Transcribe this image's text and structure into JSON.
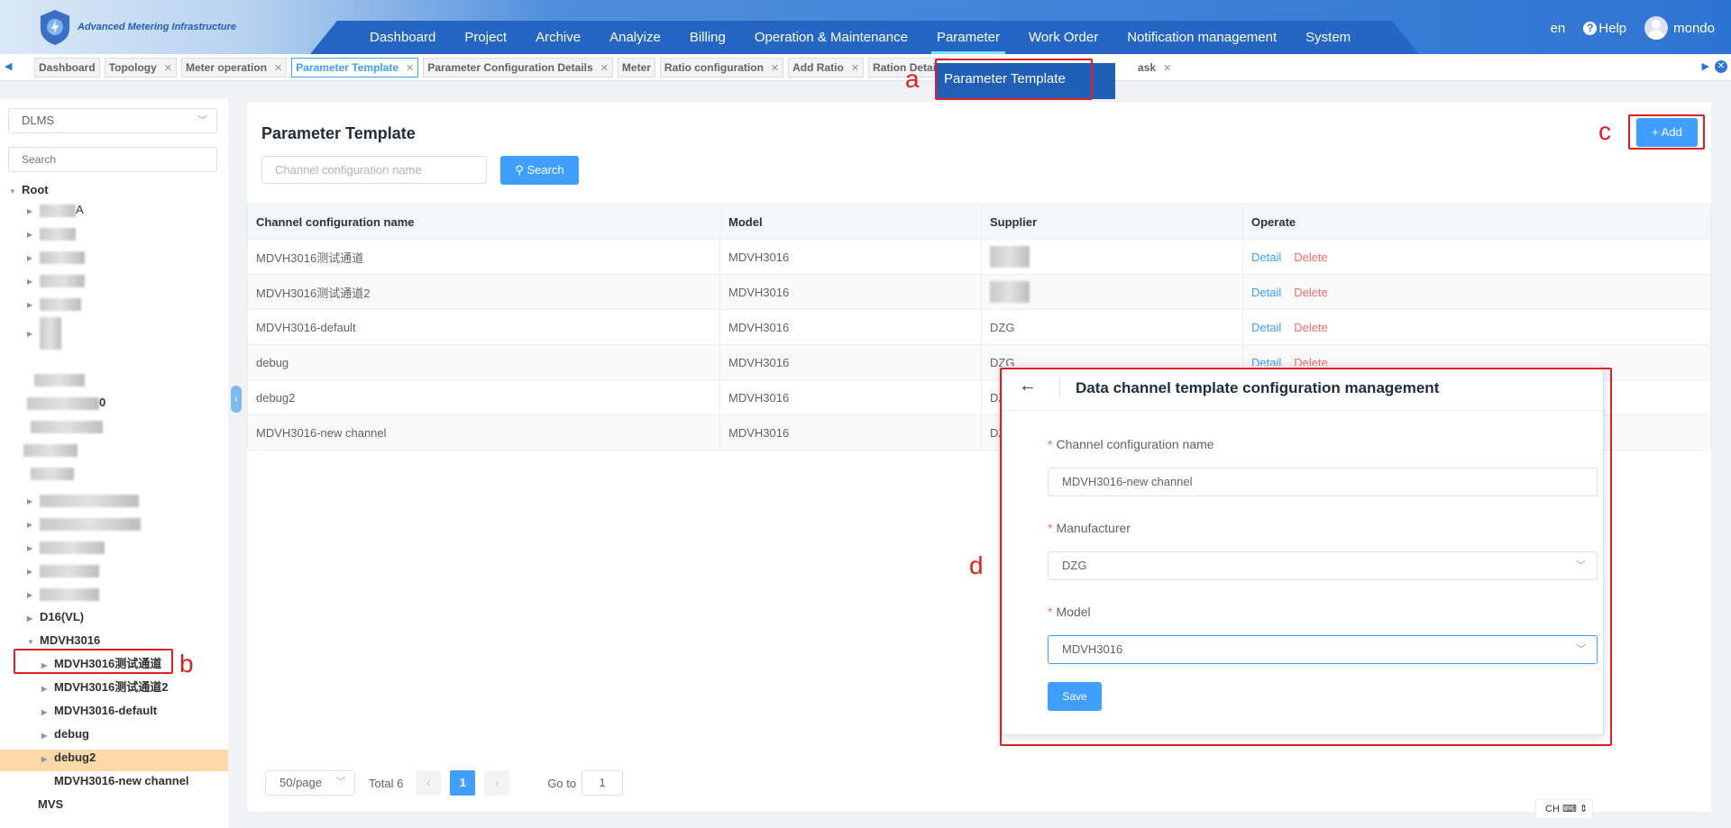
{
  "header": {
    "app_title": "Advanced Metering Infrastructure",
    "nav": [
      "Dashboard",
      "Project",
      "Archive",
      "Analyize",
      "Billing",
      "Operation & Maintenance",
      "Parameter",
      "Work Order",
      "Notification management",
      "System"
    ],
    "active_nav": "Parameter",
    "language": "en",
    "help": "Help",
    "user": "mondo"
  },
  "tabs": [
    {
      "label": "Dashboard",
      "closable": false
    },
    {
      "label": "Topology",
      "closable": true
    },
    {
      "label": "Meter operation",
      "closable": true
    },
    {
      "label": "Parameter Template",
      "closable": true,
      "active": true
    },
    {
      "label": "Parameter Configuration Details",
      "closable": true
    },
    {
      "label": "Meter",
      "closable": false
    },
    {
      "label": "Ratio configuration",
      "closable": true
    },
    {
      "label": "Add Ratio",
      "closable": true
    },
    {
      "label": "Ration Details",
      "closable": false
    },
    {
      "label": "ask",
      "closable": true
    }
  ],
  "dropdown_popup": "Parameter Template",
  "sidebar": {
    "protocol_select": "DLMS",
    "search_placeholder": "Search",
    "root": "Root",
    "visible_nodes": [
      {
        "label": "A"
      },
      {
        "label": "0"
      },
      {
        "label": "D16(VL)"
      },
      {
        "label": "MDVH3016",
        "selected": true
      },
      {
        "label": "MDVH3016测试通道"
      },
      {
        "label": "MDVH3016测试通道2"
      },
      {
        "label": "MDVH3016-default"
      },
      {
        "label": "debug"
      },
      {
        "label": "debug2"
      },
      {
        "label": "MDVH3016-new channel"
      },
      {
        "label": "MVS"
      }
    ]
  },
  "main": {
    "title": "Parameter Template",
    "name_placeholder": "Channel configuration name",
    "search_button": "Search",
    "add_button": "Add",
    "columns": [
      "Channel configuration name",
      "Model",
      "Supplier",
      "Operate"
    ],
    "rows": [
      {
        "name": "MDVH3016测试通道",
        "model": "MDVH3016",
        "supplier": ""
      },
      {
        "name": "MDVH3016测试通道2",
        "model": "MDVH3016",
        "supplier": ""
      },
      {
        "name": "MDVH3016-default",
        "model": "MDVH3016",
        "supplier": "DZG"
      },
      {
        "name": "debug",
        "model": "MDVH3016",
        "supplier": "DZG"
      },
      {
        "name": "debug2",
        "model": "MDVH3016",
        "supplier": "DZ"
      },
      {
        "name": "MDVH3016-new channel",
        "model": "MDVH3016",
        "supplier": "DZ"
      }
    ],
    "detail_label": "Detail",
    "delete_label": "Delete",
    "pagination": {
      "page_size": "50/page",
      "total": "Total 6",
      "current_page": "1",
      "goto_label": "Go to",
      "goto_value": "1"
    }
  },
  "dialog": {
    "title": "Data channel template configuration management",
    "name_label": "Channel configuration name",
    "name_value": "MDVH3016-new channel",
    "manufacturer_label": "Manufacturer",
    "manufacturer_value": "DZG",
    "model_label": "Model",
    "model_value": "MDVH3016",
    "save_button": "Save"
  },
  "annotations": [
    "a",
    "b",
    "c",
    "d"
  ],
  "ime": "CH",
  "colors": {
    "primary": "#409eff",
    "danger": "#f56c6c",
    "annotation": "#e02020",
    "nav_bg": "#2565c4",
    "selected_node": "#fdd9a8"
  }
}
